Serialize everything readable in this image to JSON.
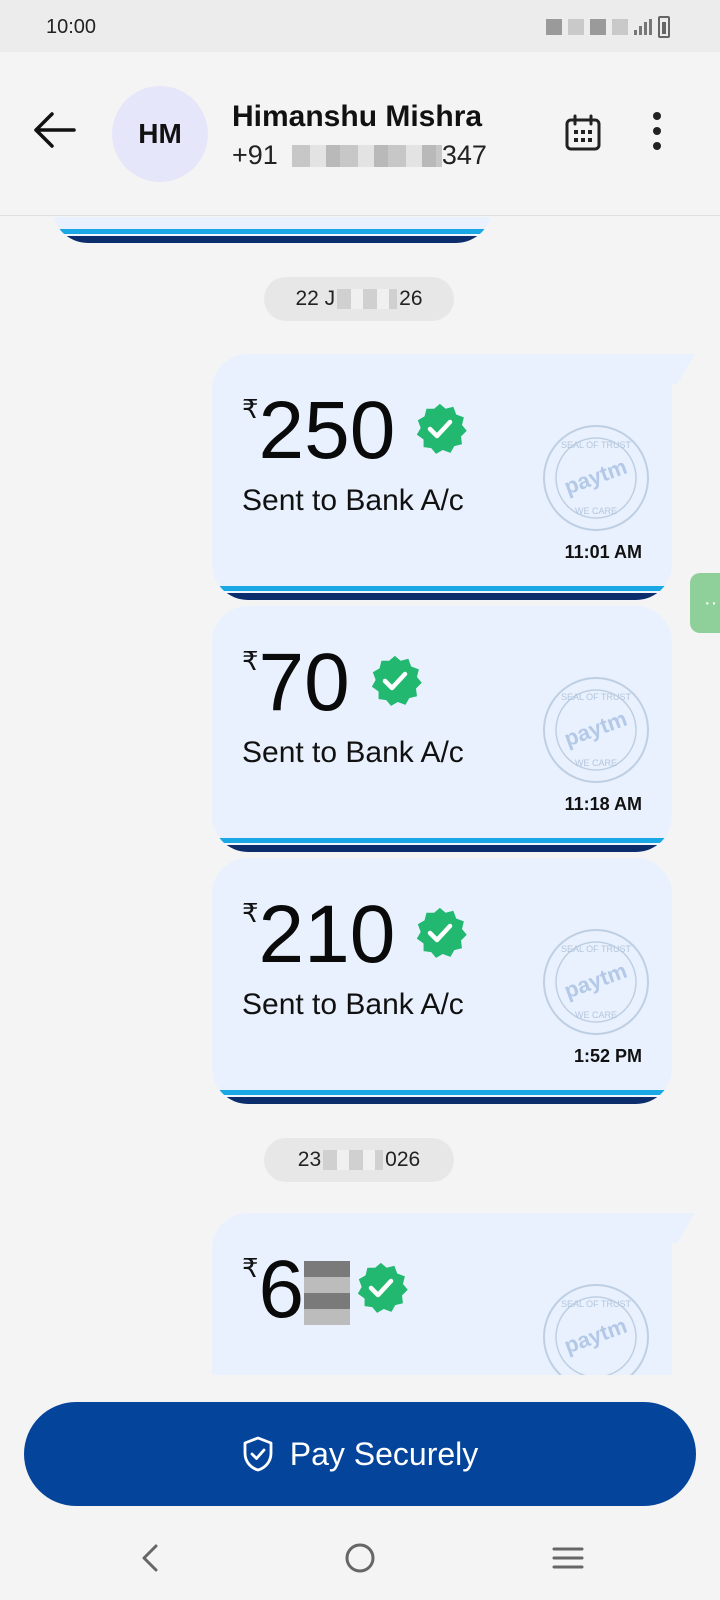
{
  "status_bar": {
    "time": "10:00"
  },
  "header": {
    "avatar_initials": "HM",
    "contact_name": "Himanshu Mishra",
    "phone_prefix": "+91",
    "phone_suffix": "347"
  },
  "chat": {
    "date_separators": [
      {
        "left": "22 J",
        "right": "26"
      },
      {
        "left": "23",
        "right": "026"
      }
    ],
    "payments": [
      {
        "currency": "₹",
        "amount": "250",
        "label": "Sent to Bank A/c",
        "time": "11:01 AM"
      },
      {
        "currency": "₹",
        "amount": "70",
        "label": "Sent to Bank A/c",
        "time": "11:18 AM"
      },
      {
        "currency": "₹",
        "amount": "210",
        "label": "Sent to Bank A/c",
        "time": "1:52 PM"
      },
      {
        "currency": "₹",
        "amount_visible": "6"
      }
    ],
    "seal_text": {
      "top": "SEAL OF TRUST",
      "brand": "paytm",
      "bottom": "WE CARE"
    },
    "side_handle_label": "··"
  },
  "pay_button": {
    "label": "Pay Securely"
  },
  "colors": {
    "primary_blue": "#05449b",
    "card_bg": "#e8f1fd",
    "verified_green": "#23b870",
    "stripe_light": "#1aa7e6",
    "stripe_dark": "#0c2d6b"
  },
  "icons": {
    "back": "arrow-left-icon",
    "calendar": "calendar-icon",
    "more": "more-vertical-icon",
    "verified": "verified-badge-icon",
    "shield": "shield-check-icon",
    "nav_back": "chevron-left-icon",
    "nav_home": "circle-home-icon",
    "nav_recents": "menu-lines-icon"
  }
}
